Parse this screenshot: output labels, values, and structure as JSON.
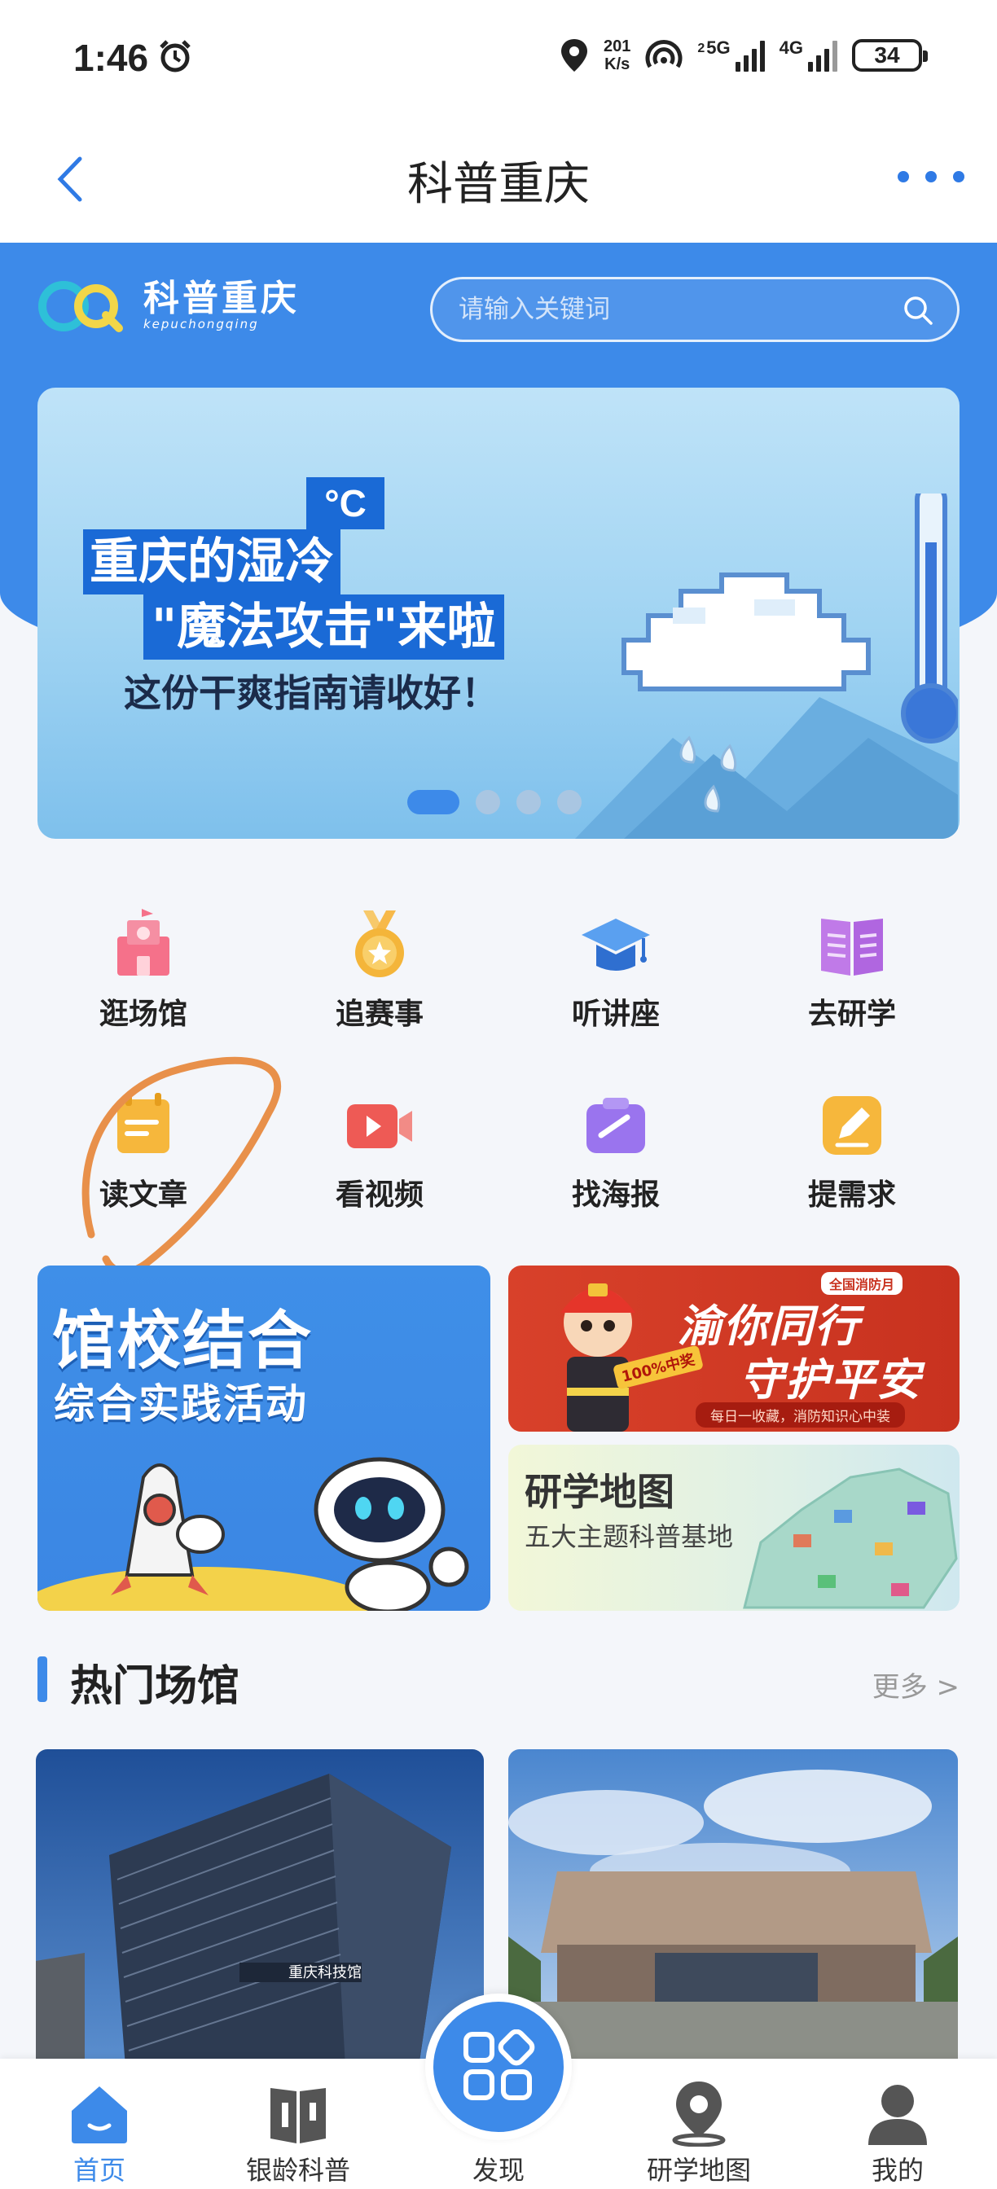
{
  "status_bar": {
    "time": "1:46",
    "net_speed_value": "201",
    "net_speed_unit": "K/s",
    "sim1_tag": "5G",
    "sim1_index": "2",
    "sim2_tag": "4G",
    "battery": "34"
  },
  "title_bar": {
    "title": "科普重庆"
  },
  "header": {
    "logo_main": "科普重庆",
    "logo_sub": "kepuchongqing",
    "search_placeholder": "请输入关键词"
  },
  "banner": {
    "degree": "°C",
    "line1": "重庆的湿冷",
    "line2": "\"魔法攻击\"来啦",
    "line3": "这份干爽指南请收好！",
    "slide_count": 4,
    "active_slide": 1
  },
  "quick_grid": [
    {
      "label": "逛场馆",
      "icon": "museum-icon"
    },
    {
      "label": "追赛事",
      "icon": "medal-icon"
    },
    {
      "label": "听讲座",
      "icon": "graduation-cap-icon"
    },
    {
      "label": "去研学",
      "icon": "open-book-icon"
    },
    {
      "label": "读文章",
      "icon": "article-icon"
    },
    {
      "label": "看视频",
      "icon": "video-icon"
    },
    {
      "label": "找海报",
      "icon": "poster-icon"
    },
    {
      "label": "提需求",
      "icon": "edit-request-icon"
    }
  ],
  "promos": {
    "left_title": "馆校结合",
    "left_sub": "综合实践活动",
    "right_top_tag": "全国消防月",
    "right_top_line1": "渝你同行",
    "right_top_line2": "守护平安",
    "right_top_badge": "100%中奖",
    "right_top_foot": "每日一收藏，消防知识心中装",
    "right_bottom_title": "研学地图",
    "right_bottom_sub": "五大主题科普基地"
  },
  "section": {
    "title": "热门场馆",
    "more": "更多 >",
    "venue1_sign": "重庆科技馆"
  },
  "bottom_nav": [
    {
      "label": "首页",
      "icon": "home-icon",
      "active": true
    },
    {
      "label": "银龄科普",
      "icon": "book-icon",
      "active": false
    },
    {
      "label": "发现",
      "icon": "discover-icon",
      "active": false
    },
    {
      "label": "研学地图",
      "icon": "location-pin-icon",
      "active": false
    },
    {
      "label": "我的",
      "icon": "profile-icon",
      "active": false
    }
  ],
  "colors": {
    "brand_blue": "#3d8ae9",
    "annotation_orange": "#e8904a"
  }
}
